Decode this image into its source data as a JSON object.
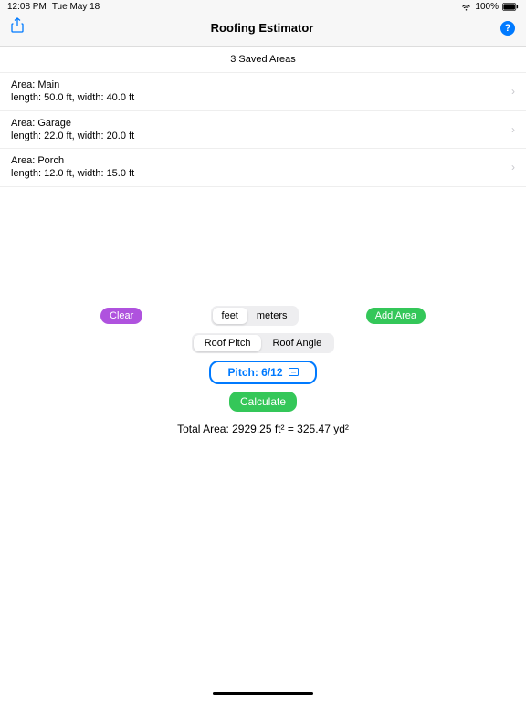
{
  "status": {
    "time": "12:08 PM",
    "date": "Tue May 18",
    "battery": "100%"
  },
  "nav": {
    "title": "Roofing Estimator"
  },
  "section_header": "3 Saved Areas",
  "areas": [
    {
      "title": "Area: Main",
      "detail": "length: 50.0 ft, width: 40.0 ft"
    },
    {
      "title": "Area: Garage",
      "detail": "length: 22.0 ft, width: 20.0 ft"
    },
    {
      "title": "Area: Porch",
      "detail": "length: 12.0 ft, width: 15.0 ft"
    }
  ],
  "buttons": {
    "clear": "Clear",
    "add": "Add Area",
    "calculate": "Calculate"
  },
  "units": {
    "opt1": "feet",
    "opt2": "meters"
  },
  "mode": {
    "opt1": "Roof Pitch",
    "opt2": "Roof Angle"
  },
  "pitch_label": "Pitch: 6/12",
  "total": "Total Area: 2929.25 ft² = 325.47 yd²"
}
